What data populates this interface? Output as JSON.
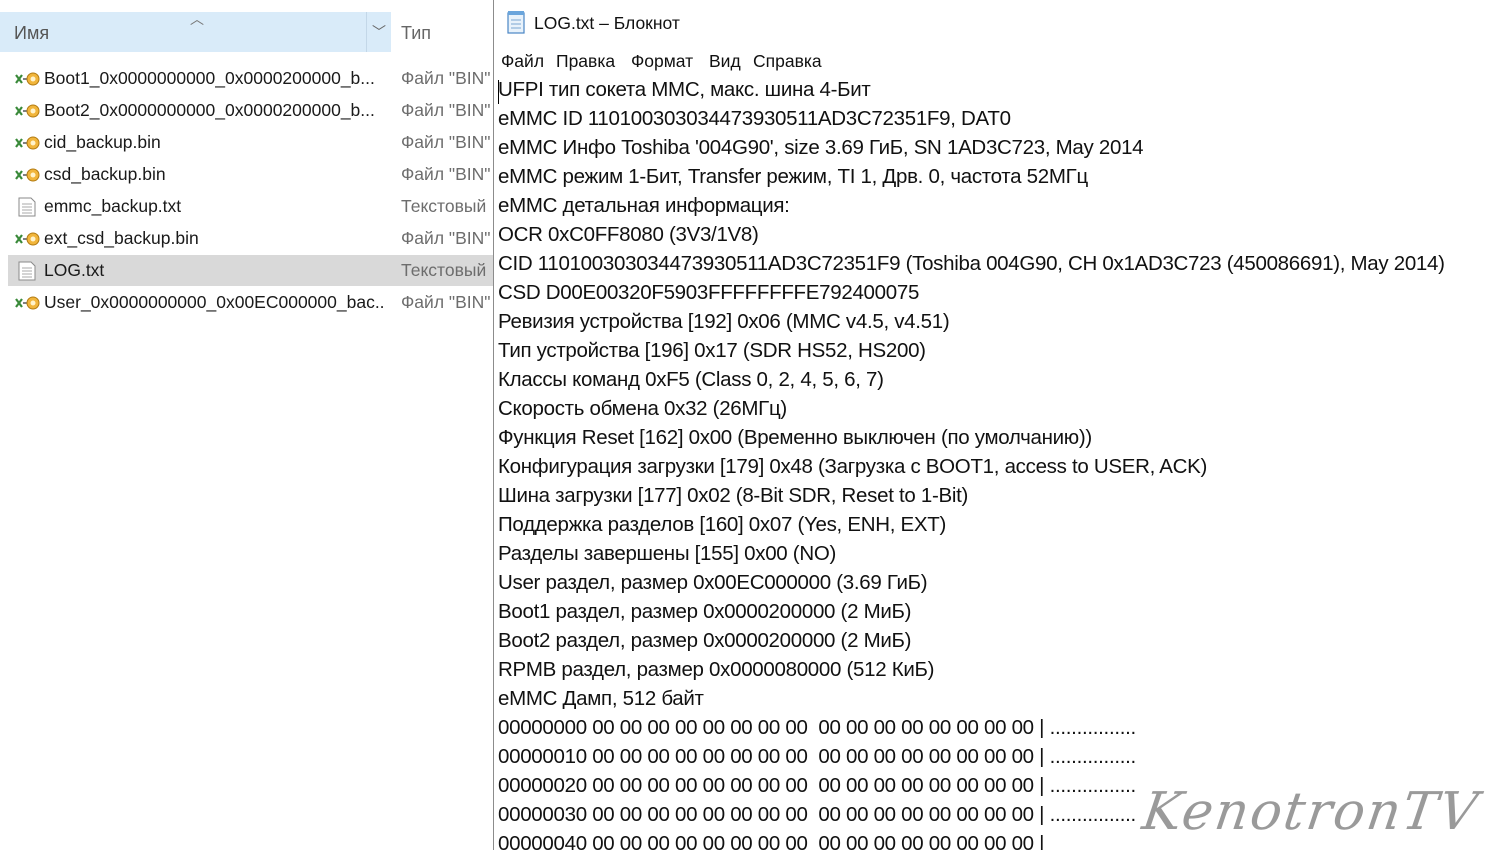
{
  "explorer": {
    "columns": {
      "name": "Имя",
      "type": "Тип"
    },
    "files": [
      {
        "name": "Boot1_0x0000000000_0x0000200000_b...",
        "type": "Файл \"BIN\"",
        "icon": "bin-file-icon",
        "selected": false
      },
      {
        "name": "Boot2_0x0000000000_0x0000200000_b...",
        "type": "Файл \"BIN\"",
        "icon": "bin-file-icon",
        "selected": false
      },
      {
        "name": "cid_backup.bin",
        "type": "Файл \"BIN\"",
        "icon": "bin-file-icon",
        "selected": false
      },
      {
        "name": "csd_backup.bin",
        "type": "Файл \"BIN\"",
        "icon": "bin-file-icon",
        "selected": false
      },
      {
        "name": "emmc_backup.txt",
        "type": "Текстовый",
        "icon": "text-file-icon",
        "selected": false
      },
      {
        "name": "ext_csd_backup.bin",
        "type": "Файл \"BIN\"",
        "icon": "bin-file-icon",
        "selected": false
      },
      {
        "name": "LOG.txt",
        "type": "Текстовый",
        "icon": "text-file-icon",
        "selected": true
      },
      {
        "name": "User_0x0000000000_0x00EC000000_bac...",
        "type": "Файл \"BIN\"",
        "icon": "bin-file-icon",
        "selected": false
      }
    ]
  },
  "notepad": {
    "title": "LOG.txt – Блокнот",
    "menu": [
      "Файл",
      "Правка",
      "Формат",
      "Вид",
      "Справка"
    ],
    "lines": [
      "UFPI тип сокета MMC, макс. шина 4-Бит",
      "eMMC ID 110100303034473930511AD3C72351F9, DAT0",
      "eMMC Инфо Toshiba '004G90', size 3.69 ГиБ, SN 1AD3C723, May 2014",
      "eMMC режим 1-Бит, Transfer режим, TI 1, Дрв. 0, частота 52МГц",
      "eMMC детальная информация:",
      "OCR 0xC0FF8080 (3V3/1V8)",
      "CID 110100303034473930511AD3C72351F9 (Toshiba 004G90, CH 0x1AD3C723 (450086691), May 2014)",
      "CSD D00E00320F5903FFFFFFFFE792400075",
      "Ревизия устройства [192] 0x06 (MMC v4.5, v4.51)",
      "Тип устройства [196] 0x17 (SDR HS52, HS200)",
      "Классы команд 0xF5 (Class 0, 2, 4, 5, 6, 7)",
      "Скорость обмена 0x32 (26МГц)",
      "Функция Reset [162] 0x00 (Временно выключен (по умолчанию))",
      "Конфигурация загрузки [179] 0x48 (Загрузка с BOOT1, access to USER, ACK)",
      "Шина загрузки [177] 0x02 (8-Bit SDR, Reset to 1-Bit)",
      "Поддержка разделов [160] 0x07 (Yes, ENH, EXT)",
      "Разделы завершены [155] 0x00 (NO)",
      "User раздел, размер 0x00EC000000 (3.69 ГиБ)",
      "Boot1 раздел, размер 0x0000200000 (2 МиБ)",
      "Boot2 раздел, размер 0x0000200000 (2 МиБ)",
      "RPMB раздел, размер 0x0000080000 (512 КиБ)",
      "eMMC Дамп, 512 байт",
      "00000000 00 00 00 00 00 00 00 00  00 00 00 00 00 00 00 00 | ................",
      "00000010 00 00 00 00 00 00 00 00  00 00 00 00 00 00 00 00 | ................",
      "00000020 00 00 00 00 00 00 00 00  00 00 00 00 00 00 00 00 | ................",
      "00000030 00 00 00 00 00 00 00 00  00 00 00 00 00 00 00 00 | ................",
      "00000040 00 00 00 00 00 00 00 00  00 00 00 00 00 00 00 00 | "
    ]
  },
  "watermark": "KenotronTV",
  "colors": {
    "header_bg": "#d9ebf9",
    "selected_row": "#d9d9d9"
  }
}
